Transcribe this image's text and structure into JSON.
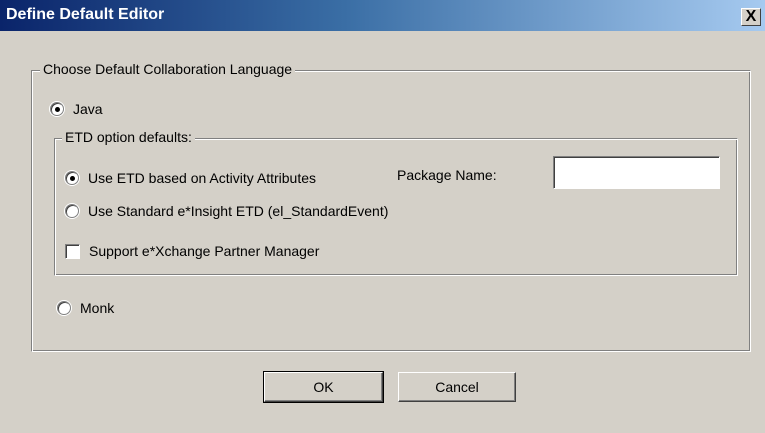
{
  "window": {
    "title": "Define Default Editor",
    "close_label": "X"
  },
  "language_group": {
    "legend": "Choose Default Collaboration Language",
    "java_label": "Java",
    "monk_label": "Monk",
    "selected": "Java"
  },
  "etd_group": {
    "legend": "ETD option defaults:",
    "option_activity_label": "Use ETD based on Activity Attributes",
    "option_standard_label": "Use Standard e*Insight ETD (el_StandardEvent)",
    "selected": "Use ETD based on Activity Attributes",
    "partner_manager_label": "Support e*Xchange Partner Manager",
    "partner_manager_checked": false,
    "package_name_label": "Package Name:",
    "package_name_value": ""
  },
  "buttons": {
    "ok_label": "OK",
    "cancel_label": "Cancel"
  },
  "colors": {
    "dialog_bg": "#d4d0c8",
    "titlebar_start": "#0a246a",
    "titlebar_end": "#a6caf0"
  }
}
